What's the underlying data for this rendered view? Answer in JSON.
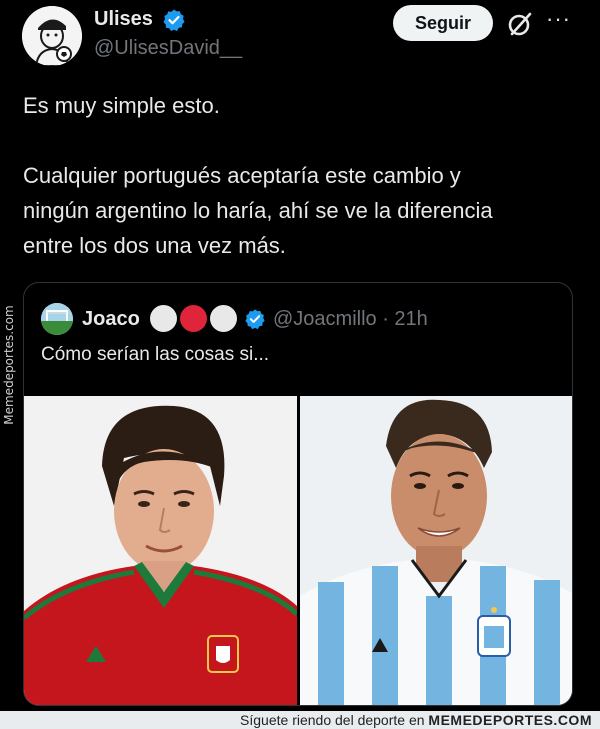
{
  "header": {
    "display_name": "Ulises",
    "handle": "@UlisesDavid__",
    "follow_label": "Seguir",
    "more_label": "···",
    "icons": [
      "verified-badge-icon",
      "grok-icon",
      "more-options-icon"
    ]
  },
  "tweet": {
    "text": "Es muy simple esto.\n\nCualquier portugués aceptaría este cambio y\nningún argentino lo haría, ahí se ve la diferencia\nentre los dos una vez más."
  },
  "quote": {
    "display_name": "Joaco",
    "handle_time": "@Joacmillo · 21h",
    "text": "Cómo serían las cosas si...",
    "emoji_dots": [
      "#e8e8e8",
      "#e0243a",
      "#e8e8e8"
    ],
    "images": [
      "player-in-portugal-jersey",
      "player-in-argentina-jersey"
    ]
  },
  "watermark": {
    "side_text": "Memedeportes.com",
    "footer_text": "Síguete riendo del deporte en",
    "footer_brand": "MEMEDEPORTES.COM"
  },
  "colors": {
    "background": "#000000",
    "text": "#e7e9ea",
    "muted": "#71767b",
    "verified": "#1d9bf0",
    "border": "#2f3336"
  }
}
